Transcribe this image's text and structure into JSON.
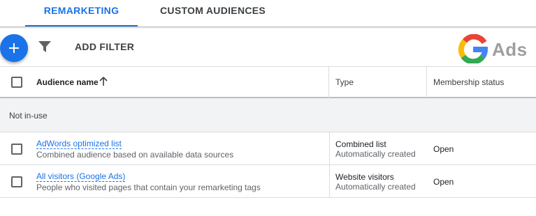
{
  "tabs": [
    {
      "label": "REMARKETING",
      "active": true
    },
    {
      "label": "CUSTOM AUDIENCES",
      "active": false
    }
  ],
  "toolbar": {
    "add_icon": "plus-icon",
    "filter_icon": "funnel-filter-icon",
    "add_filter_label": "ADD FILTER"
  },
  "logo": {
    "text": "Ads",
    "colors": {
      "blue": "#4285f4",
      "red": "#ea4335",
      "yellow": "#fbbc05",
      "green": "#34a853",
      "text_gray": "#9e9e9e"
    }
  },
  "table": {
    "headers": {
      "name": "Audience name",
      "sort_icon": "arrow-up-icon",
      "type": "Type",
      "status": "Membership status"
    },
    "group_label": "Not in-use",
    "rows": [
      {
        "name": "AdWords optimized list",
        "description": "Combined audience based on available data sources",
        "type": "Combined list",
        "type_sub": "Automatically created",
        "status": "Open"
      },
      {
        "name": "All visitors (Google Ads)",
        "description": "People who visited pages that contain your remarketing tags",
        "type": "Website visitors",
        "type_sub": "Automatically created",
        "status": "Open"
      }
    ]
  },
  "colors": {
    "accent": "#1a73e8",
    "group_bg": "#f1f3f4",
    "border": "#dadce0"
  }
}
